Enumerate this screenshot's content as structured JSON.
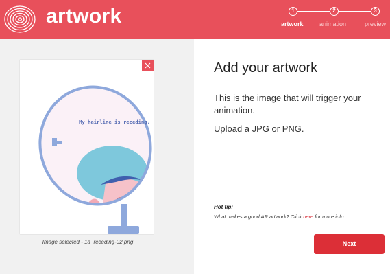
{
  "header": {
    "title": "artwork",
    "logo_icon": "concentric-rings-logo-icon",
    "accent_color": "#e8505b"
  },
  "steps": [
    {
      "number": "1",
      "label": "artwork",
      "active": true
    },
    {
      "number": "2",
      "label": "animation",
      "active": false
    },
    {
      "number": "3",
      "label": "preview",
      "active": false
    }
  ],
  "preview": {
    "artwork_text": "My hairline is receding.",
    "caption": "Image selected - 1a_receding-02.png",
    "remove_icon": "close-icon"
  },
  "main": {
    "heading": "Add your artwork",
    "description": "This is the image that will trigger your animation.",
    "upload_hint": "Upload a JPG or PNG.",
    "tip_title": "Hot tip:",
    "tip_before": "What makes a good AR artwork? Click ",
    "tip_link": "here",
    "tip_after": " for more info.",
    "next_label": "Next",
    "next_color": "#dc2f37"
  }
}
